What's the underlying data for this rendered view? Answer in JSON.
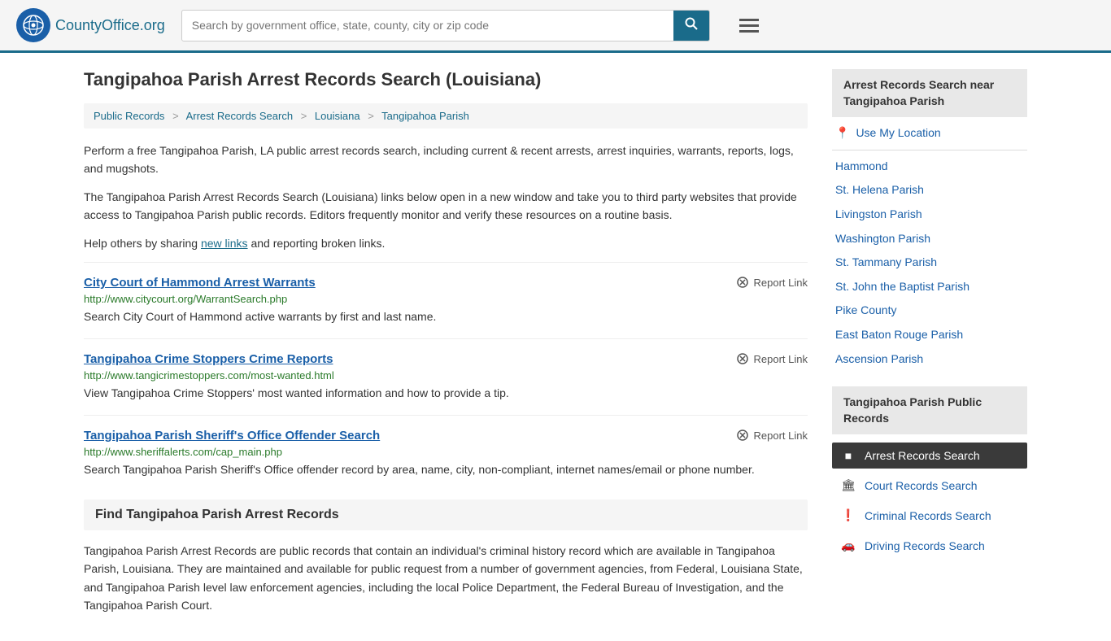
{
  "header": {
    "logo_text": "CountyOffice",
    "logo_suffix": ".org",
    "search_placeholder": "Search by government office, state, county, city or zip code",
    "search_value": ""
  },
  "breadcrumb": {
    "items": [
      {
        "label": "Public Records",
        "href": "#"
      },
      {
        "label": "Arrest Records Search",
        "href": "#"
      },
      {
        "label": "Louisiana",
        "href": "#"
      },
      {
        "label": "Tangipahoa Parish",
        "href": "#"
      }
    ]
  },
  "page": {
    "title": "Tangipahoa Parish Arrest Records Search (Louisiana)",
    "intro1": "Perform a free Tangipahoa Parish, LA public arrest records search, including current & recent arrests, arrest inquiries, warrants, reports, logs, and mugshots.",
    "intro2": "The Tangipahoa Parish Arrest Records Search (Louisiana) links below open in a new window and take you to third party websites that provide access to Tangipahoa Parish public records. Editors frequently monitor and verify these resources on a routine basis.",
    "intro3_pre": "Help others by sharing ",
    "intro3_link": "new links",
    "intro3_post": " and reporting broken links."
  },
  "results": [
    {
      "title": "City Court of Hammond Arrest Warrants",
      "url": "http://www.citycourt.org/WarrantSearch.php",
      "description": "Search City Court of Hammond active warrants by first and last name."
    },
    {
      "title": "Tangipahoa Crime Stoppers Crime Reports",
      "url": "http://www.tangicrimestoppers.com/most-wanted.html",
      "description": "View Tangipahoa Crime Stoppers' most wanted information and how to provide a tip."
    },
    {
      "title": "Tangipahoa Parish Sheriff's Office Offender Search",
      "url": "http://www.sheriffalerts.com/cap_main.php",
      "description": "Search Tangipahoa Parish Sheriff's Office offender record by area, name, city, non-compliant, internet names/email or phone number."
    }
  ],
  "report_link_label": "Report Link",
  "find_section": {
    "header": "Find Tangipahoa Parish Arrest Records",
    "body": "Tangipahoa Parish Arrest Records are public records that contain an individual's criminal history record which are available in Tangipahoa Parish, Louisiana. They are maintained and available for public request from a number of government agencies, from Federal, Louisiana State, and Tangipahoa Parish level law enforcement agencies, including the local Police Department, the Federal Bureau of Investigation, and the Tangipahoa Parish Court."
  },
  "sidebar": {
    "nearby_title": "Arrest Records Search near Tangipahoa Parish",
    "use_my_location": "Use My Location",
    "nearby_items": [
      {
        "label": "Hammond"
      },
      {
        "label": "St. Helena Parish"
      },
      {
        "label": "Livingston Parish"
      },
      {
        "label": "Washington Parish"
      },
      {
        "label": "St. Tammany Parish"
      },
      {
        "label": "St. John the Baptist Parish"
      },
      {
        "label": "Pike County"
      },
      {
        "label": "East Baton Rouge Parish"
      },
      {
        "label": "Ascension Parish"
      }
    ],
    "public_records_title": "Tangipahoa Parish Public Records",
    "public_records_items": [
      {
        "label": "Arrest Records Search",
        "active": true,
        "icon": "■"
      },
      {
        "label": "Court Records Search",
        "active": false,
        "icon": "🏛"
      },
      {
        "label": "Criminal Records Search",
        "active": false,
        "icon": "❗"
      },
      {
        "label": "Driving Records Search",
        "active": false,
        "icon": "🚗"
      }
    ]
  }
}
